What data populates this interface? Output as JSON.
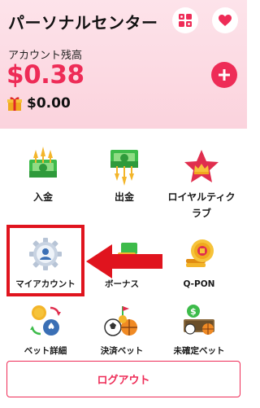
{
  "header": {
    "title": "パーソナルセンター",
    "balance_label": "アカウント残高",
    "balance_value": "$0.38",
    "bonus_value": "$0.00"
  },
  "menu": {
    "deposit": "入金",
    "withdraw": "出金",
    "royalty": "ロイヤルティクラブ",
    "my_account": "マイアカウント",
    "bonus": "ボーナス",
    "qpon": "Q-PON",
    "bet_details": "ベット詳細",
    "settled_bets": "決済ベット",
    "unsettled_bets": "未確定ベット"
  },
  "logout_label": "ログアウト",
  "colors": {
    "accent": "#ee2c57",
    "header_bg": "#fbd8e1",
    "highlight": "#e0141e"
  },
  "icons": {
    "grid": "grid-icon",
    "heart": "heart-icon",
    "add": "plus-icon",
    "gift": "gift-icon"
  }
}
